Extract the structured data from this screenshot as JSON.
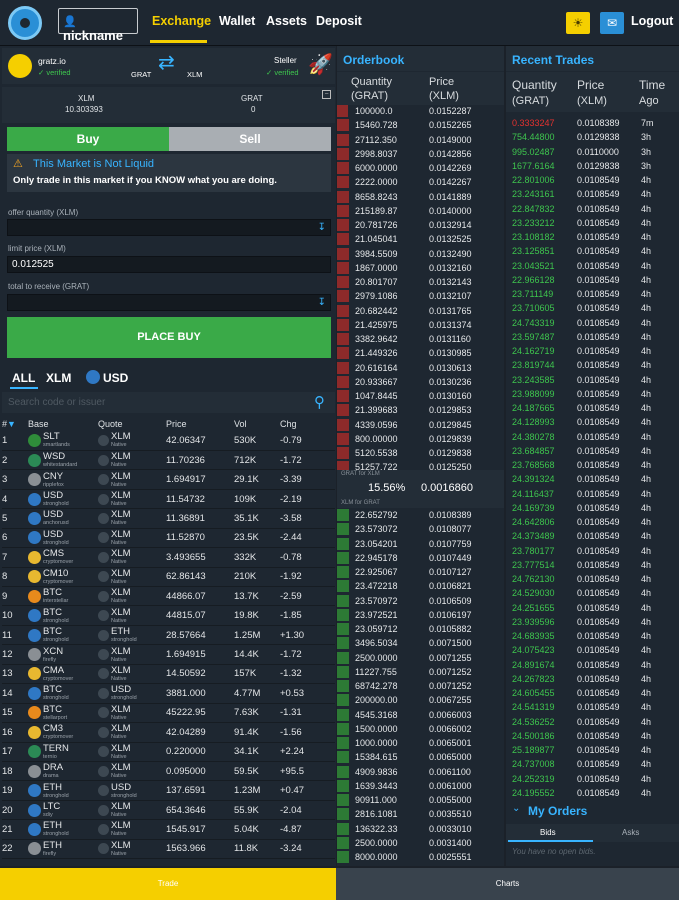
{
  "header": {
    "nickname": "nickname",
    "nav": [
      "Exchange",
      "Wallet",
      "Assets",
      "Deposit"
    ],
    "logout": "Logout",
    "icons": {
      "theme": "sun-icon",
      "chat": "chat-icon"
    }
  },
  "pair": {
    "base_name": "gratz.io",
    "base_status": "verified",
    "base_code": "GRAT",
    "counter_code": "XLM",
    "counter_name": "Steller",
    "counter_status": "verified"
  },
  "balances": {
    "xlm_label": "XLM",
    "xlm_value": "10.303393",
    "grat_label": "GRAT",
    "grat_value": "0"
  },
  "trade": {
    "buy": "Buy",
    "sell": "Sell",
    "warning_title": "This Market is Not Liquid",
    "warning_text": "Only trade in this market if you KNOW what you are doing.",
    "offer_label": "offer quantity (XLM)",
    "offer_value": "",
    "price_label": "limit price (XLM)",
    "price_value": "0.012525",
    "total_label": "total to receive (GRAT)",
    "total_value": "",
    "submit": "PLACE BUY"
  },
  "filters": {
    "all": "ALL",
    "xlm": "XLM",
    "usd": "USD",
    "search_placeholder": "Search code or issuer"
  },
  "market_table": {
    "headers": [
      "#",
      "Base",
      "Quote",
      "Price",
      "Vol",
      "Chg"
    ],
    "rows": [
      [
        "1",
        "SLT",
        "smartlands",
        "XLM",
        "Native",
        "42.06347",
        "530K",
        "-0.79",
        "#2f8c3a"
      ],
      [
        "2",
        "WSD",
        "whitestandard",
        "XLM",
        "Native",
        "11.70236",
        "712K",
        "-1.72",
        "#2b8a55"
      ],
      [
        "3",
        "CNY",
        "ripplefox",
        "XLM",
        "Native",
        "1.694917",
        "29.1K",
        "-3.39",
        "#8a8f94"
      ],
      [
        "4",
        "USD",
        "stronghold",
        "XLM",
        "Native",
        "11.54732",
        "109K",
        "-2.19",
        "#2f78c4"
      ],
      [
        "5",
        "USD",
        "anchorusd",
        "XLM",
        "Native",
        "11.36891",
        "35.1K",
        "-3.58",
        "#2f78c4"
      ],
      [
        "6",
        "USD",
        "stronghold",
        "XLM",
        "Native",
        "11.52870",
        "23.5K",
        "-2.44",
        "#2f78c4"
      ],
      [
        "7",
        "CMS",
        "cryptomover",
        "XLM",
        "Native",
        "3.493655",
        "332K",
        "-0.78",
        "#e8b830"
      ],
      [
        "8",
        "CM10",
        "cryptomover",
        "XLM",
        "Native",
        "62.86143",
        "210K",
        "-1.92",
        "#e8b830"
      ],
      [
        "9",
        "BTC",
        "interstellar",
        "XLM",
        "Native",
        "44866.07",
        "13.7K",
        "-2.59",
        "#e88a1c"
      ],
      [
        "10",
        "BTC",
        "stronghold",
        "XLM",
        "Native",
        "44815.07",
        "19.8K",
        "-1.85",
        "#2f78c4"
      ],
      [
        "11",
        "BTC",
        "stronghold",
        "ETH",
        "stronghold",
        "28.57664",
        "1.25M",
        "+1.30",
        "#2f78c4"
      ],
      [
        "12",
        "XCN",
        "firefly",
        "XLM",
        "Native",
        "1.694915",
        "14.4K",
        "-1.72",
        "#8a8f94"
      ],
      [
        "13",
        "CMA",
        "cryptomover",
        "XLM",
        "Native",
        "14.50592",
        "157K",
        "-1.32",
        "#e8b830"
      ],
      [
        "14",
        "BTC",
        "stronghold",
        "USD",
        "stronghold",
        "3881.000",
        "4.77M",
        "+0.53",
        "#2f78c4"
      ],
      [
        "15",
        "BTC",
        "stellarport",
        "XLM",
        "Native",
        "45222.95",
        "7.63K",
        "-1.31",
        "#e88a1c"
      ],
      [
        "16",
        "CM3",
        "cryptomover",
        "XLM",
        "Native",
        "42.04289",
        "91.4K",
        "-1.56",
        "#e8b830"
      ],
      [
        "17",
        "TERN",
        "ternio",
        "XLM",
        "Native",
        "0.220000",
        "34.1K",
        "+2.24",
        "#2b8a55"
      ],
      [
        "18",
        "DRA",
        "drama",
        "XLM",
        "Native",
        "0.095000",
        "59.5K",
        "+95.5",
        "#8a8f94"
      ],
      [
        "19",
        "ETH",
        "stronghold",
        "USD",
        "stronghold",
        "137.6591",
        "1.23M",
        "+0.47",
        "#2f78c4"
      ],
      [
        "20",
        "LTC",
        "sdiy",
        "XLM",
        "Native",
        "654.3646",
        "55.9K",
        "-2.04",
        "#2f78c4"
      ],
      [
        "21",
        "ETH",
        "stronghold",
        "XLM",
        "Native",
        "1545.917",
        "5.04K",
        "-4.87",
        "#2f78c4"
      ],
      [
        "22",
        "ETH",
        "firefly",
        "XLM",
        "Native",
        "1563.966",
        "11.8K",
        "-3.24",
        "#8a8f94"
      ]
    ]
  },
  "orderbook": {
    "title": "Orderbook",
    "col_qty": "Quantity",
    "col_qty_unit": "(GRAT)",
    "col_price": "Price",
    "col_price_unit": "(XLM)",
    "asks": [
      [
        "100000.0",
        "0.0152287"
      ],
      [
        "15460.728",
        "0.0152265"
      ],
      [
        "27112.350",
        "0.0149000"
      ],
      [
        "2998.8037",
        "0.0142856"
      ],
      [
        "6000.0000",
        "0.0142269"
      ],
      [
        "2222.0000",
        "0.0142267"
      ],
      [
        "8658.8243",
        "0.0141889"
      ],
      [
        "215189.87",
        "0.0140000"
      ],
      [
        "20.781726",
        "0.0132914"
      ],
      [
        "21.045041",
        "0.0132525"
      ],
      [
        "3984.5509",
        "0.0132490"
      ],
      [
        "1867.0000",
        "0.0132160"
      ],
      [
        "20.801707",
        "0.0132143"
      ],
      [
        "2979.1086",
        "0.0132107"
      ],
      [
        "20.682442",
        "0.0131765"
      ],
      [
        "21.425975",
        "0.0131374"
      ],
      [
        "3382.9642",
        "0.0131160"
      ],
      [
        "21.449326",
        "0.0130985"
      ],
      [
        "20.616164",
        "0.0130613"
      ],
      [
        "20.933667",
        "0.0130236"
      ],
      [
        "1047.8445",
        "0.0130160"
      ],
      [
        "21.399683",
        "0.0129853"
      ],
      [
        "4339.0596",
        "0.0129845"
      ],
      [
        "800.00000",
        "0.0129839"
      ],
      [
        "5120.5538",
        "0.0129838"
      ],
      [
        "51257.722",
        "0.0125250"
      ]
    ],
    "ask_label": "GRAT for XLM",
    "spread_pct": "15.56%",
    "spread_val": "0.0016860",
    "bid_label": "XLM for GRAT",
    "bids": [
      [
        "22.652792",
        "0.0108389"
      ],
      [
        "23.573072",
        "0.0108077"
      ],
      [
        "23.054201",
        "0.0107759"
      ],
      [
        "22.945178",
        "0.0107449"
      ],
      [
        "22.925067",
        "0.0107127"
      ],
      [
        "23.472218",
        "0.0106821"
      ],
      [
        "23.570972",
        "0.0106509"
      ],
      [
        "23.972521",
        "0.0106197"
      ],
      [
        "23.059712",
        "0.0105882"
      ],
      [
        "3496.5034",
        "0.0071500"
      ],
      [
        "2500.0000",
        "0.0071255"
      ],
      [
        "11227.755",
        "0.0071252"
      ],
      [
        "68742.278",
        "0.0071252"
      ],
      [
        "200000.00",
        "0.0067255"
      ],
      [
        "4545.3168",
        "0.0066003"
      ],
      [
        "1500.0000",
        "0.0066002"
      ],
      [
        "1000.0000",
        "0.0065001"
      ],
      [
        "15384.615",
        "0.0065000"
      ],
      [
        "4909.9836",
        "0.0061100"
      ],
      [
        "1639.3443",
        "0.0061000"
      ],
      [
        "90911.000",
        "0.0055000"
      ],
      [
        "2816.1081",
        "0.0035510"
      ],
      [
        "136322.33",
        "0.0033010"
      ],
      [
        "2500.0000",
        "0.0031400"
      ],
      [
        "8000.0000",
        "0.0025551"
      ]
    ]
  },
  "recent_trades": {
    "title": "Recent Trades",
    "col_qty": "Quantity",
    "col_qty_unit": "(GRAT)",
    "col_price": "Price",
    "col_price_unit": "(XLM)",
    "col_time": "Time",
    "col_time_unit": "Ago",
    "rows": [
      [
        "0.3333247",
        "0.0108389",
        "7m",
        "neg"
      ],
      [
        "754.44800",
        "0.0129838",
        "3h",
        "pos"
      ],
      [
        "995.02487",
        "0.0110000",
        "3h",
        "pos"
      ],
      [
        "1677.6164",
        "0.0129838",
        "3h",
        "pos"
      ],
      [
        "22.801006",
        "0.0108549",
        "4h",
        "pos"
      ],
      [
        "23.243161",
        "0.0108549",
        "4h",
        "pos"
      ],
      [
        "22.847832",
        "0.0108549",
        "4h",
        "pos"
      ],
      [
        "23.233212",
        "0.0108549",
        "4h",
        "pos"
      ],
      [
        "23.108182",
        "0.0108549",
        "4h",
        "pos"
      ],
      [
        "23.125851",
        "0.0108549",
        "4h",
        "pos"
      ],
      [
        "23.043521",
        "0.0108549",
        "4h",
        "pos"
      ],
      [
        "22.966128",
        "0.0108549",
        "4h",
        "pos"
      ],
      [
        "23.711149",
        "0.0108549",
        "4h",
        "pos"
      ],
      [
        "23.710605",
        "0.0108549",
        "4h",
        "pos"
      ],
      [
        "24.743319",
        "0.0108549",
        "4h",
        "pos"
      ],
      [
        "23.597487",
        "0.0108549",
        "4h",
        "pos"
      ],
      [
        "24.162719",
        "0.0108549",
        "4h",
        "pos"
      ],
      [
        "23.819744",
        "0.0108549",
        "4h",
        "pos"
      ],
      [
        "23.243585",
        "0.0108549",
        "4h",
        "pos"
      ],
      [
        "23.988099",
        "0.0108549",
        "4h",
        "pos"
      ],
      [
        "24.187665",
        "0.0108549",
        "4h",
        "pos"
      ],
      [
        "24.128993",
        "0.0108549",
        "4h",
        "pos"
      ],
      [
        "24.380278",
        "0.0108549",
        "4h",
        "pos"
      ],
      [
        "23.684857",
        "0.0108549",
        "4h",
        "pos"
      ],
      [
        "23.768568",
        "0.0108549",
        "4h",
        "pos"
      ],
      [
        "24.391324",
        "0.0108549",
        "4h",
        "pos"
      ],
      [
        "24.116437",
        "0.0108549",
        "4h",
        "pos"
      ],
      [
        "24.169739",
        "0.0108549",
        "4h",
        "pos"
      ],
      [
        "24.642806",
        "0.0108549",
        "4h",
        "pos"
      ],
      [
        "24.373489",
        "0.0108549",
        "4h",
        "pos"
      ],
      [
        "23.780177",
        "0.0108549",
        "4h",
        "pos"
      ],
      [
        "23.777514",
        "0.0108549",
        "4h",
        "pos"
      ],
      [
        "24.762130",
        "0.0108549",
        "4h",
        "pos"
      ],
      [
        "24.529030",
        "0.0108549",
        "4h",
        "pos"
      ],
      [
        "24.251655",
        "0.0108549",
        "4h",
        "pos"
      ],
      [
        "23.939596",
        "0.0108549",
        "4h",
        "pos"
      ],
      [
        "24.683935",
        "0.0108549",
        "4h",
        "pos"
      ],
      [
        "24.075423",
        "0.0108549",
        "4h",
        "pos"
      ],
      [
        "24.891674",
        "0.0108549",
        "4h",
        "pos"
      ],
      [
        "24.267823",
        "0.0108549",
        "4h",
        "pos"
      ],
      [
        "24.605455",
        "0.0108549",
        "4h",
        "pos"
      ],
      [
        "24.541319",
        "0.0108549",
        "4h",
        "pos"
      ],
      [
        "24.536252",
        "0.0108549",
        "4h",
        "pos"
      ],
      [
        "24.500186",
        "0.0108549",
        "4h",
        "pos"
      ],
      [
        "25.189877",
        "0.0108549",
        "4h",
        "pos"
      ],
      [
        "24.737008",
        "0.0108549",
        "4h",
        "pos"
      ],
      [
        "24.252319",
        "0.0108549",
        "4h",
        "pos"
      ],
      [
        "24.195552",
        "0.0108549",
        "4h",
        "pos"
      ]
    ]
  },
  "my_orders": {
    "title": "My Orders",
    "tab_bids": "Bids",
    "tab_asks": "Asks",
    "empty": "You have no open bids."
  },
  "footer": {
    "trade": "Trade",
    "charts": "Charts"
  }
}
